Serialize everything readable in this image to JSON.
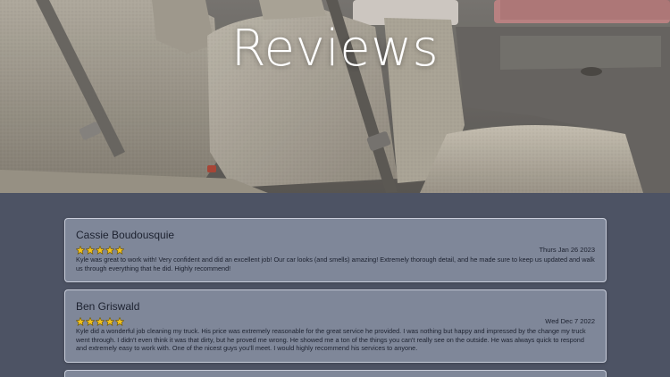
{
  "hero": {
    "title": "Reviews"
  },
  "reviews": [
    {
      "name": "Cassie Boudousquie",
      "rating": 5,
      "date": "Thurs Jan 26 2023",
      "text": "Kyle was great to work with! Very confident and did an excellent job! Our car looks (and smells) amazing! Extremely thorough detail, and he made sure to keep us updated and walk us through everything that he did. Highly recommend!"
    },
    {
      "name": "Ben Griswald",
      "rating": 5,
      "date": "Wed Dec 7 2022",
      "text": "Kyle did a wonderful job cleaning my truck. His price was extremely reasonable for the great service he provided. I was nothing but happy and impressed by the change my truck went through. I didn't even think it was that dirty, but he proved me wrong. He showed me a ton of the things you can't really see on the outside. He was always quick to respond and extremely easy to work with. One of the nicest guys you'll meet. I would highly recommend his services to anyone."
    }
  ],
  "colors": {
    "star_fill": "#f2c21b",
    "star_stroke": "#6b5200",
    "title": "#ffffff"
  },
  "icons": {
    "star": "star-icon"
  }
}
